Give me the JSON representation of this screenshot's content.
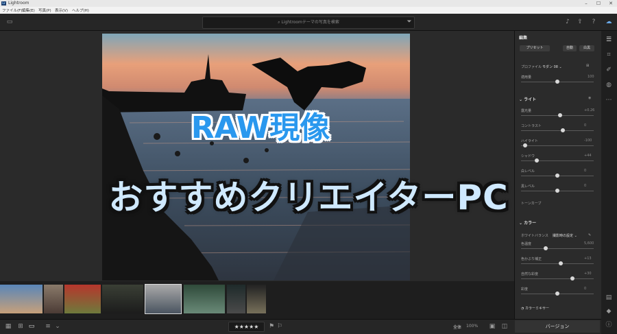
{
  "window": {
    "title": "Lightroom",
    "badge": "Lr"
  },
  "menu": [
    "ファイル(F)",
    "編集(E)",
    "写真(P)",
    "表示(V)",
    "ヘルプ(H)"
  ],
  "search": {
    "placeholder": "Lightroomテーマの写真を検索"
  },
  "overlay": {
    "title": "RAW現像",
    "subtitle": "おすすめクリエイターPC"
  },
  "panel": {
    "heading": "編集",
    "preset_button": "プリセット",
    "auto_button": "自動",
    "bw_button": "白黒",
    "profile_label": "プロファイル",
    "profile_value": "モダン 08",
    "amount_label": "適用量",
    "amount_value": "100",
    "light_section": "ライト",
    "light_sliders": [
      {
        "label": "露光量",
        "value": "+0.26",
        "pos": 0.54
      },
      {
        "label": "コントラスト",
        "value": "0",
        "pos": 0.58
      },
      {
        "label": "ハイライト",
        "value": "-100",
        "pos": 0.03
      },
      {
        "label": "シャドウ",
        "value": "+44",
        "pos": 0.2
      },
      {
        "label": "白レベル",
        "value": "0",
        "pos": 0.5
      },
      {
        "label": "黒レベル",
        "value": "0",
        "pos": 0.5
      }
    ],
    "curve_label": "トーンカーブ",
    "color_section": "カラー",
    "wb_label": "ホワイトバランス",
    "wb_value": "撮影時の設定",
    "color_sliders": [
      {
        "label": "色温度",
        "value": "5,600",
        "pos": 0.33
      },
      {
        "label": "色かぶり補正",
        "value": "+13",
        "pos": 0.55
      },
      {
        "label": "自然な彩度",
        "value": "+30",
        "pos": 0.72
      },
      {
        "label": "彩度",
        "value": "0",
        "pos": 0.5
      }
    ],
    "mixer_label": "カラーミキサー"
  },
  "bottom": {
    "rating": 3,
    "stars": "★★★★★",
    "fit_label": "全体",
    "zoom_value": "100%",
    "version_button": "バージョン"
  },
  "colors": {
    "accent": "#2a98ee",
    "panel_bg": "#2b2b2b"
  }
}
